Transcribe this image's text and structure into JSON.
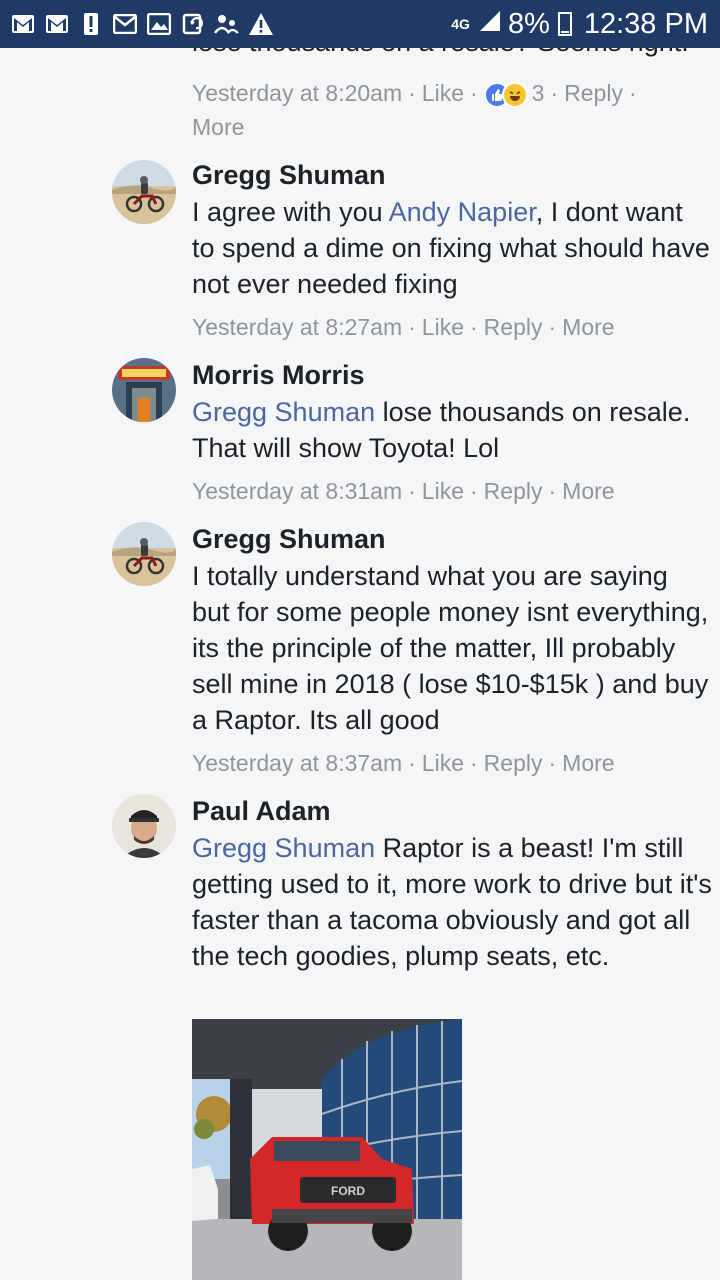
{
  "status_bar": {
    "network": "4G",
    "battery": "8%",
    "time": "12:38 PM"
  },
  "prev_comment": {
    "text_fragment": "lose thousands on a resale? Seems right.",
    "time": "Yesterday at 8:20am",
    "like": "Like",
    "reaction_count": "3",
    "reply": "Reply",
    "more": "More"
  },
  "comments": [
    {
      "author": "Gregg Shuman",
      "mention": "Andy Napier",
      "lines": [
        "I agree with you ",
        ", I dont want",
        "to spend a dime on fixing what should",
        "have not ever needed fixing"
      ],
      "pre": "I agree with you ",
      "post": ", I dont want to spend a dime on fixing what should have not ever needed fixing",
      "time": "Yesterday at 8:27am",
      "like": "Like",
      "reply": "Reply",
      "more": "More"
    },
    {
      "author": "Morris Morris",
      "mention": "Gregg Shuman",
      "post": " lose thousands on resale. That will show Toyota! Lol",
      "time": "Yesterday at 8:31am",
      "like": "Like",
      "reply": "Reply",
      "more": "More"
    },
    {
      "author": "Gregg Shuman",
      "text": "I totally understand what you are saying but for some people money isnt everything, its the principle of the matter, Ill probably sell mine in 2018 ( lose $10-$15k ) and buy a Raptor. Its all good",
      "time": "Yesterday at 8:37am",
      "like": "Like",
      "reply": "Reply",
      "more": "More"
    },
    {
      "author": "Paul Adam",
      "mention": "Gregg Shuman",
      "post": " Raptor is a beast! I'm still getting used to it, more work to drive but it's faster than a tacoma obviously and got all the tech goodies, plump seats, etc.",
      "photo_plate": "FORD"
    }
  ],
  "colors": {
    "status_bar": "#1f3a66",
    "mention": "#4b67a1",
    "meta": "#90949c",
    "background": "#f5f6f7"
  }
}
